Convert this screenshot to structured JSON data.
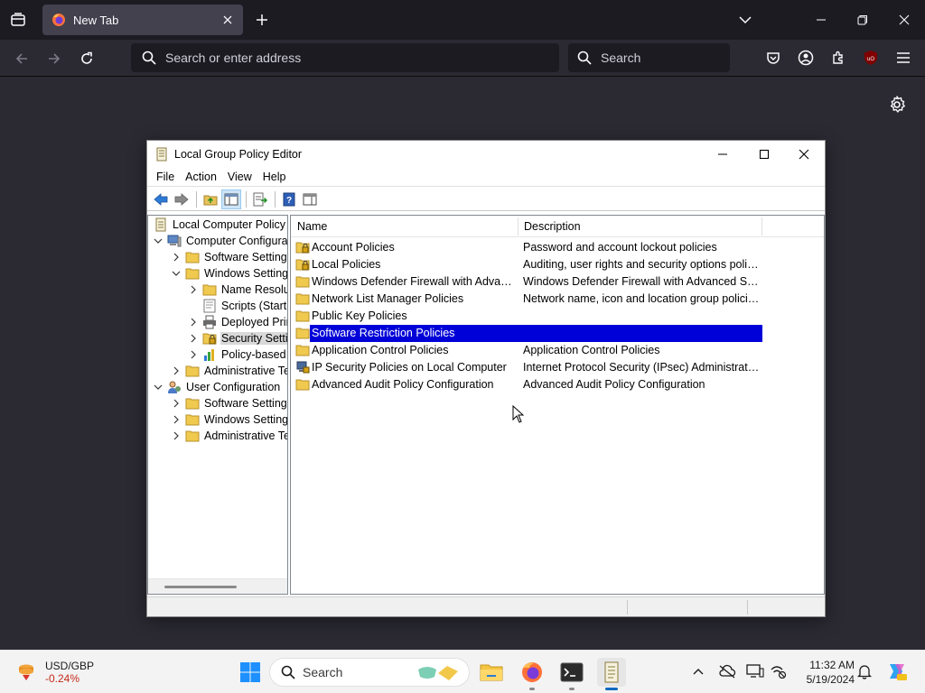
{
  "browser": {
    "tab_title": "New Tab",
    "url_placeholder": "Search or enter address",
    "search_placeholder": "Search",
    "extension_badge": "uO"
  },
  "window": {
    "title": "Local Group Policy Editor",
    "menu": [
      "File",
      "Action",
      "View",
      "Help"
    ]
  },
  "tree": [
    {
      "label": "Local Computer Policy",
      "icon": "policy-doc-icon",
      "level": 0,
      "expander": "none"
    },
    {
      "label": "Computer Configura",
      "icon": "computer-icon",
      "level": 0,
      "expander": "expanded"
    },
    {
      "label": "Software Settings",
      "icon": "folder-icon",
      "level": 1,
      "expander": "collapsed"
    },
    {
      "label": "Windows Setting",
      "icon": "folder-icon",
      "level": 1,
      "expander": "expanded"
    },
    {
      "label": "Name Resoluti",
      "icon": "folder-icon",
      "level": 2,
      "expander": "collapsed"
    },
    {
      "label": "Scripts (Startu",
      "icon": "scripts-icon",
      "level": 2,
      "expander": "none"
    },
    {
      "label": "Deployed Prin",
      "icon": "printer-icon",
      "level": 2,
      "expander": "collapsed"
    },
    {
      "label": "Security Setti",
      "icon": "security-folder-icon",
      "level": 2,
      "expander": "collapsed",
      "selected": true
    },
    {
      "label": "Policy-based",
      "icon": "chart-icon",
      "level": 2,
      "expander": "collapsed"
    },
    {
      "label": "Administrative Te",
      "icon": "folder-icon",
      "level": 1,
      "expander": "collapsed"
    },
    {
      "label": "User Configuration",
      "icon": "user-icon",
      "level": 0,
      "expander": "expanded"
    },
    {
      "label": "Software Settings",
      "icon": "folder-icon",
      "level": 1,
      "expander": "collapsed"
    },
    {
      "label": "Windows Setting",
      "icon": "folder-icon",
      "level": 1,
      "expander": "collapsed"
    },
    {
      "label": "Administrative Te",
      "icon": "folder-icon",
      "level": 1,
      "expander": "collapsed"
    }
  ],
  "list": {
    "columns": [
      "Name",
      "Description"
    ],
    "rows": [
      {
        "name": "Account Policies",
        "description": "Password and account lockout policies",
        "icon": "security-folder-icon"
      },
      {
        "name": "Local Policies",
        "description": "Auditing, user rights and security options polici...",
        "icon": "security-folder-icon"
      },
      {
        "name": "Windows Defender Firewall with Advanc...",
        "description": "Windows Defender Firewall with Advanced Sec...",
        "icon": "folder-icon"
      },
      {
        "name": "Network List Manager Policies",
        "description": "Network name, icon and location group policies.",
        "icon": "folder-icon"
      },
      {
        "name": "Public Key Policies",
        "description": "",
        "icon": "folder-icon"
      },
      {
        "name": "Software Restriction Policies",
        "description": "",
        "icon": "folder-icon",
        "selected": true
      },
      {
        "name": "Application Control Policies",
        "description": "Application Control Policies",
        "icon": "folder-icon"
      },
      {
        "name": "IP Security Policies on Local Computer",
        "description": "Internet Protocol Security (IPsec) Administratio...",
        "icon": "ipsec-icon"
      },
      {
        "name": "Advanced Audit Policy Configuration",
        "description": "Advanced Audit Policy Configuration",
        "icon": "folder-icon"
      }
    ]
  },
  "taskbar": {
    "widget_title": "USD/GBP",
    "widget_change": "-0.24%",
    "search_label": "Search",
    "time": "11:32 AM",
    "date": "5/19/2024"
  },
  "colors": {
    "selection": "#0000d8",
    "firefox_bg": "#2b2a33",
    "taskbar_bg": "#f3f3f3"
  }
}
